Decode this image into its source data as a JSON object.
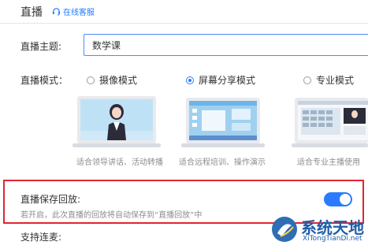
{
  "header": {
    "title": "直播",
    "support_link": "在线客服",
    "support_icon": "headset-icon"
  },
  "topic": {
    "label": "直播主题:",
    "value": "数学课"
  },
  "mode": {
    "label": "直播模式：",
    "options": [
      {
        "label": "摄像模式",
        "selected": false,
        "caption": "适合领导讲话、活动转播"
      },
      {
        "label": "屏幕分享模式",
        "selected": true,
        "caption": "适合远程培训、操作演示"
      },
      {
        "label": "专业模式",
        "selected": false,
        "caption": "适合专业主播使用"
      }
    ]
  },
  "save": {
    "label": "直播保存回放:",
    "description": "若开启，此次直播的回放将自动保存到“直播回放”中",
    "enabled": true
  },
  "mic": {
    "label": "支持连麦:"
  },
  "watermark": {
    "title": "系统天地",
    "subtitle": "XiTongTianDi.net"
  },
  "colors": {
    "accent": "#2a7bff",
    "highlight_border": "#e1252f",
    "caption": "#8c8c8c",
    "watermark": "#1f5da8"
  }
}
